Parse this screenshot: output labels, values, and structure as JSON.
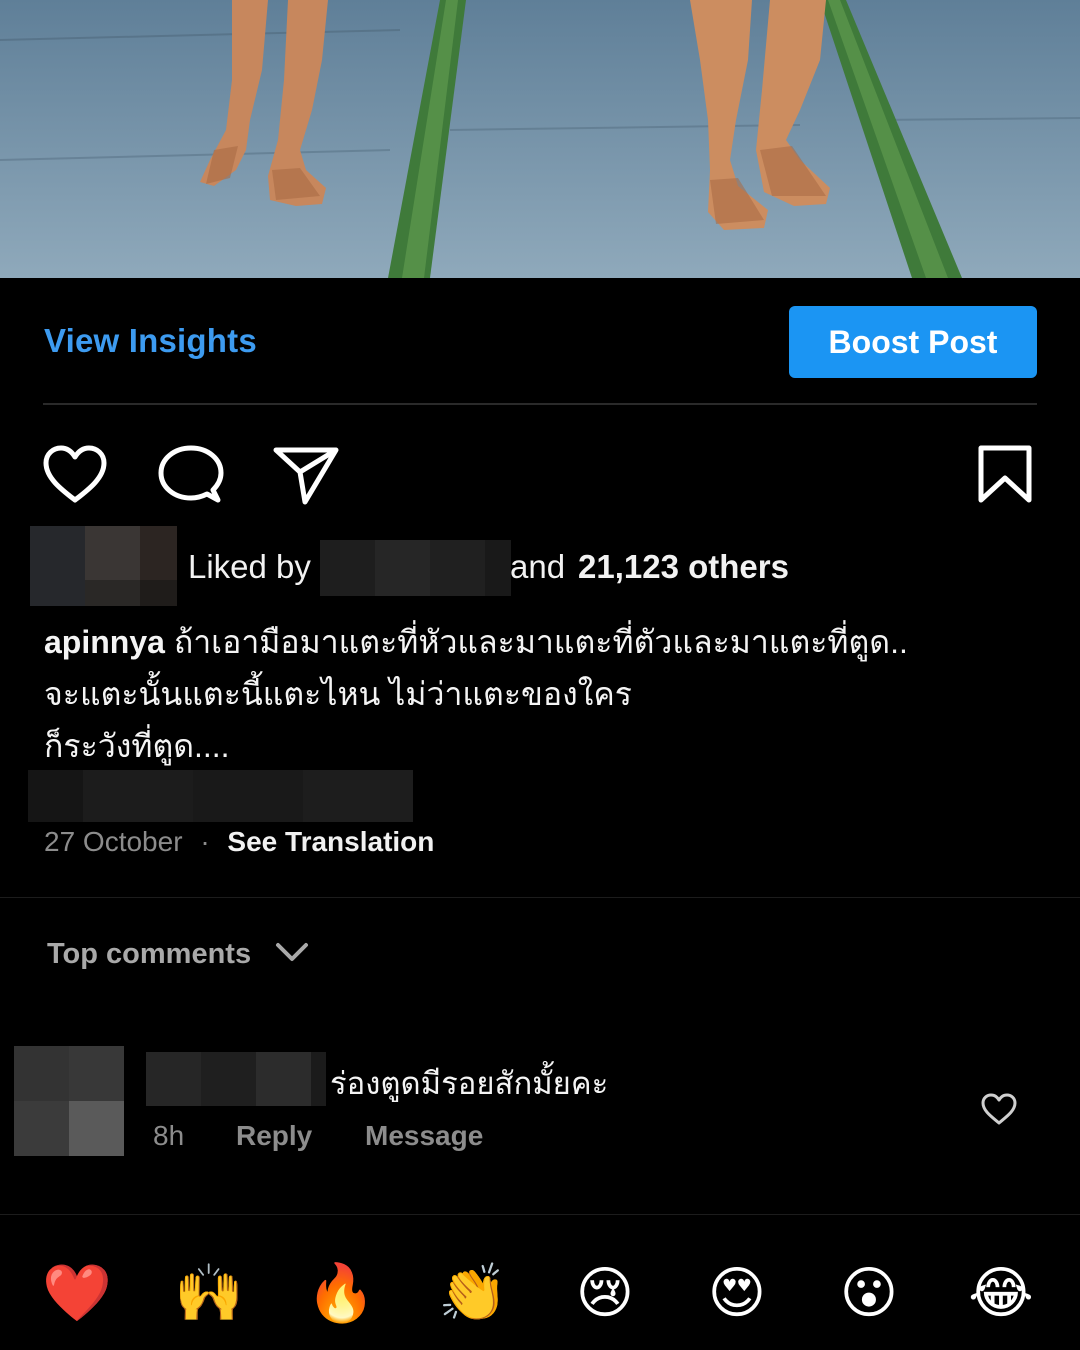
{
  "post": {
    "view_insights_label": "View Insights",
    "boost_post_label": "Boost Post"
  },
  "actions": {
    "like_icon": "heart-icon",
    "comment_icon": "comment-bubble-icon",
    "share_icon": "send-paper-plane-icon",
    "save_icon": "bookmark-icon"
  },
  "likes": {
    "liked_by_label": "Liked by",
    "and_label": "and",
    "count_label": "21,123 others"
  },
  "caption": {
    "username": "apinnya",
    "line1": "ถ้าเอามือมาแตะที่หัวและมาแตะที่ตัวและมาแตะที่ตูด..",
    "line2": "จะแตะนั้นแตะนี้แตะไหน ไม่ว่าแตะของใคร",
    "line3": "ก็ระวังที่ตูด...."
  },
  "meta": {
    "date": "27 October",
    "separator": "·",
    "see_translation": "See Translation"
  },
  "comments_header": {
    "label": "Top comments",
    "icon": "chevron-down-icon"
  },
  "comment": {
    "text": "ร่องตูดมีรอยสักมั้ยคะ",
    "time": "8h",
    "reply_label": "Reply",
    "message_label": "Message",
    "like_icon": "heart-icon"
  },
  "reactions": [
    "❤️",
    "🙌",
    "🔥",
    "👏",
    "😢",
    "😍",
    "😮",
    "😂"
  ],
  "colors": {
    "accent_link": "#3d9bf0",
    "boost_button": "#1b95f3",
    "background": "#000000",
    "muted_text": "#8c8c8c"
  }
}
